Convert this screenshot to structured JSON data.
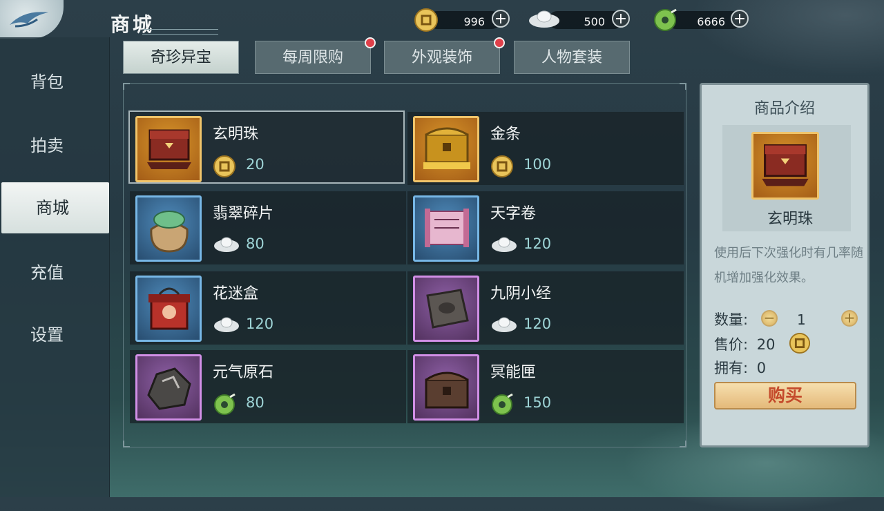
{
  "header": {
    "title": "商城"
  },
  "currencies": [
    {
      "icon": "copper-coin-icon",
      "value": "996"
    },
    {
      "icon": "silver-ingot-icon",
      "value": "500"
    },
    {
      "icon": "jade-coin-icon",
      "value": "6666"
    }
  ],
  "sidebar": {
    "items": [
      {
        "label": "背包"
      },
      {
        "label": "拍卖"
      },
      {
        "label": "商城"
      },
      {
        "label": "充值"
      },
      {
        "label": "设置"
      }
    ],
    "active": "商城"
  },
  "tabs": [
    {
      "label": "奇珍异宝",
      "active": true,
      "badge": false
    },
    {
      "label": "每周限购",
      "active": false,
      "badge": true
    },
    {
      "label": "外观装饰",
      "active": false,
      "badge": true
    },
    {
      "label": "人物套装",
      "active": false,
      "badge": false
    }
  ],
  "items": [
    {
      "name": "玄明珠",
      "price": "20",
      "currency": "copper-coin-icon",
      "frame": "gold",
      "icon": "red-chest-icon"
    },
    {
      "name": "金条",
      "price": "100",
      "currency": "copper-coin-icon",
      "frame": "gold",
      "icon": "gold-chest-icon"
    },
    {
      "name": "翡翠碎片",
      "price": "80",
      "currency": "silver-ingot-icon",
      "frame": "blue",
      "icon": "jade-bag-icon"
    },
    {
      "name": "天字卷",
      "price": "120",
      "currency": "silver-ingot-icon",
      "frame": "blue",
      "icon": "scroll-icon"
    },
    {
      "name": "花迷盒",
      "price": "120",
      "currency": "silver-ingot-icon",
      "frame": "blue",
      "icon": "flower-box-icon"
    },
    {
      "name": "九阴小经",
      "price": "120",
      "currency": "silver-ingot-icon",
      "frame": "purple",
      "icon": "stone-tablet-icon"
    },
    {
      "name": "元气原石",
      "price": "80",
      "currency": "jade-coin-icon",
      "frame": "purple",
      "icon": "ore-icon"
    },
    {
      "name": "冥能匣",
      "price": "150",
      "currency": "jade-coin-icon",
      "frame": "purple",
      "icon": "dark-chest-icon"
    }
  ],
  "detail": {
    "title": "商品介绍",
    "name": "玄明珠",
    "description": "使用后下次强化时有几率随机增加强化效果。",
    "quantity_label": "数量:",
    "quantity": "1",
    "price_label": "售价:",
    "price": "20",
    "owned_label": "拥有:",
    "owned": "0",
    "buy_label": "购买"
  },
  "colors": {
    "accent_red": "#e0404a",
    "price_text": "#9ed4d6",
    "buy_text": "#c44a2b"
  }
}
